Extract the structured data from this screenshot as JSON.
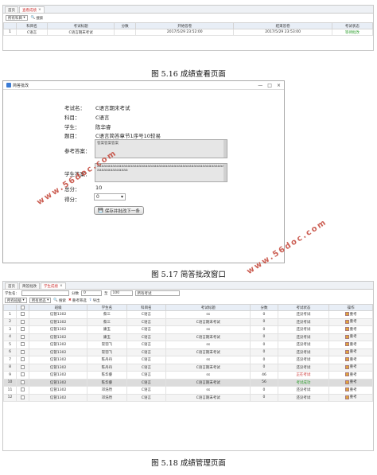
{
  "fig1": {
    "tabs": [
      {
        "label": "首页"
      },
      {
        "label": "查看成绩",
        "close": "×"
      }
    ],
    "filter_select": "所有科目",
    "search_btn": "搜索",
    "headers": [
      "",
      "科目名",
      "考试标题",
      "分数",
      "开始答卷",
      "结束答卷",
      "考试状态"
    ],
    "rows": [
      [
        "1",
        "C语言",
        "C语言期末考试",
        "",
        "2017/5/29 23:52:00",
        "2017/5/29 23:53:00",
        "等待批改"
      ]
    ],
    "caption": "图 5.16 成绩查看页面"
  },
  "fig2": {
    "window_title": "简答批改",
    "window_controls": {
      "min": "—",
      "max": "□",
      "close": "×"
    },
    "labels": {
      "exam": "考试名：",
      "subject": "科目：",
      "student": "学生：",
      "question": "题目：",
      "ref_answer": "参考答案：",
      "student_answer": "学生答案：",
      "full_score": "总分：",
      "score": "得分："
    },
    "values": {
      "exam": "C语言期末考试",
      "subject": "C语言",
      "student": "陈华睿",
      "question": "C语言简答章节1序号10较易",
      "ref_answer": "答案答案答案",
      "student_answer": "aaaaaaaaaaaaaaaaaaaaaaaaaaaaaaaaaaaaaaaaaaaaaaaaaaaaaaaaaaaaaaaaaaaaaaaa",
      "full_score": "10",
      "score": "0"
    },
    "save_btn": "保存并批改下一条",
    "caption": "图 5.17 简答批改窗口"
  },
  "fig3": {
    "tabs": [
      {
        "label": "首页"
      },
      {
        "label": "简答批改"
      },
      {
        "label": "学生成绩",
        "close": "×"
      }
    ],
    "filter_student": "学生名：",
    "filter_score": "分数",
    "score_from": "0",
    "score_to_label": "至",
    "score_to": "100",
    "exam_select": "所有考试",
    "class_select": "所有班级",
    "status_select": "所有状态",
    "search_btn": "搜索",
    "view_btn": "重考筛选",
    "export_btn": "导出",
    "headers": [
      "",
      "",
      "班级",
      "学生名",
      "科目名",
      "考试标题",
      "分数",
      "考试状态",
      "操作"
    ],
    "rows": [
      [
        "1",
        "信管1302",
        "蔡三",
        "C语言",
        "ss",
        "0",
        "还没考试",
        "重考"
      ],
      [
        "2",
        "信管1302",
        "蔡三",
        "C语言",
        "C语言期末考试",
        "0",
        "还没考试",
        "重考"
      ],
      [
        "3",
        "信管1302",
        "康玉",
        "C语言",
        "ss",
        "0",
        "还没考试",
        "重考"
      ],
      [
        "4",
        "信管1302",
        "康玉",
        "C语言",
        "C语言期末考试",
        "0",
        "还没考试",
        "重考"
      ],
      [
        "5",
        "信管1302",
        "常羽飞",
        "C语言",
        "ss",
        "0",
        "还没考试",
        "重考"
      ],
      [
        "6",
        "信管1302",
        "常羽飞",
        "C语言",
        "C语言期末考试",
        "0",
        "还没考试",
        "重考"
      ],
      [
        "7",
        "信管1302",
        "陈丹丹",
        "C语言",
        "ss",
        "0",
        "还没考试",
        "重考"
      ],
      [
        "8",
        "信管1302",
        "陈丹丹",
        "C语言",
        "C语言期末考试",
        "0",
        "还没考试",
        "重考"
      ],
      [
        "9",
        "信管1302",
        "陈华睿",
        "C语言",
        "ss",
        "46",
        "正在考试",
        "重考"
      ],
      [
        "10",
        "信管1302",
        "陈华睿",
        "C语言",
        "C语言期末考试",
        "56",
        "考试成功",
        "重考"
      ],
      [
        "11",
        "信管1302",
        "邓浩然",
        "C语言",
        "ss",
        "0",
        "还没考试",
        "重考"
      ],
      [
        "12",
        "信管1302",
        "邓浩然",
        "C语言",
        "C语言期末考试",
        "0",
        "还没考试",
        "重考"
      ]
    ],
    "caption": "图 5.18 成绩管理页面"
  },
  "watermark": "www.56doc.com",
  "colors": {
    "accent": "#3a7bd5",
    "status_green": "#2a9d2a",
    "tab_red": "#cc3333",
    "watermark": "#c0392b"
  }
}
